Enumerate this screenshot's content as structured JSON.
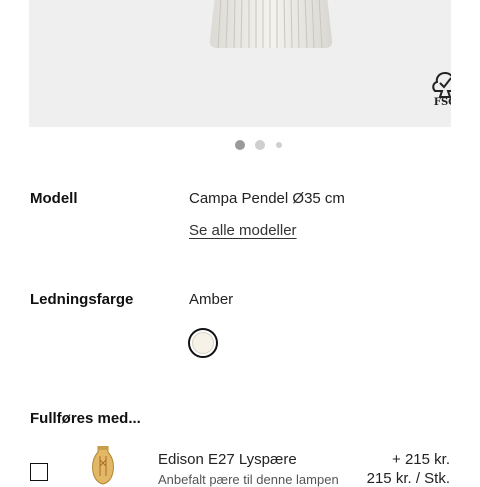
{
  "hero": {
    "fsc_label": "FSC",
    "carousel": {
      "total": 3,
      "active": 1
    }
  },
  "model": {
    "label": "Modell",
    "value": "Campa Pendel Ø35 cm",
    "link": "Se alle modeller"
  },
  "cord": {
    "label": "Ledningsfarge",
    "value": "Amber",
    "swatch_color": "#f6f2e8"
  },
  "complete": {
    "heading": "Fullføres med...",
    "items": [
      {
        "name": "Edison E27 Lyspære",
        "price": "+ 215 kr.",
        "unit_price": "215 kr. / Stk.",
        "subtitle": "Anbefalt pære til denne lampen",
        "checked": false
      }
    ]
  }
}
